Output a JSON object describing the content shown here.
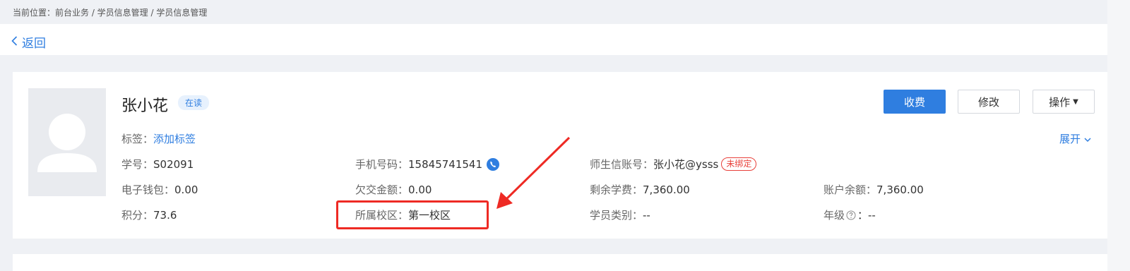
{
  "breadcrumb": "当前位置：前台业务 / 学员信息管理 / 学员信息管理",
  "back_label": "返回",
  "student": {
    "name": "张小花",
    "status": "在读",
    "tags_label": "标签：",
    "add_tag": "添加标签",
    "expand": "展开"
  },
  "actions": {
    "charge": "收费",
    "edit": "修改",
    "ops": "操作"
  },
  "fields": {
    "student_no": {
      "label": "学号：",
      "value": "S02091"
    },
    "phone": {
      "label": "手机号码：",
      "value": "15845741541"
    },
    "account": {
      "label": "师生信账号：",
      "value": "张小花@ysss",
      "badge": "未绑定"
    },
    "ewallet": {
      "label": "电子钱包：",
      "value": "0.00"
    },
    "arrears": {
      "label": "欠交金额：",
      "value": "0.00"
    },
    "remaining_fee": {
      "label": "剩余学费：",
      "value": "7,360.00"
    },
    "balance": {
      "label": "账户余额：",
      "value": "7,360.00"
    },
    "points": {
      "label": "积分：",
      "value": "73.6"
    },
    "campus": {
      "label": "所属校区：",
      "value": "第一校区"
    },
    "category": {
      "label": "学员类别：",
      "value": "--"
    },
    "grade": {
      "label": "年级",
      "value": "：--"
    }
  },
  "colors": {
    "primary": "#2f7ee0",
    "annotation": "#ee2a24"
  },
  "icons": [
    "chevron-left-icon",
    "chevron-down-icon",
    "phone-icon",
    "help-icon",
    "avatar-placeholder"
  ]
}
